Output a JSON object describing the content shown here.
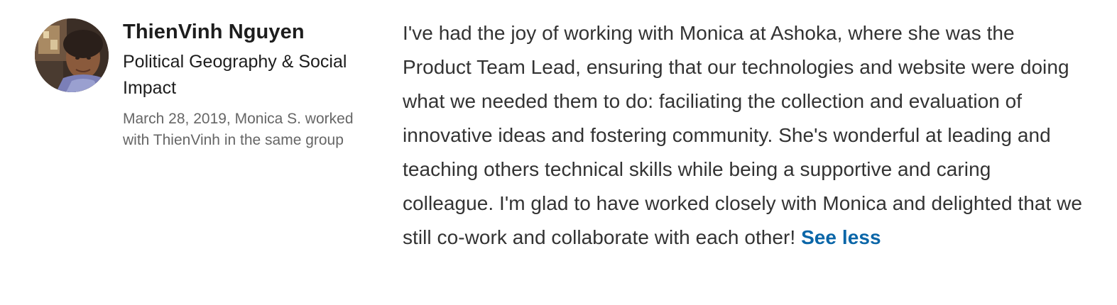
{
  "recommender": {
    "avatar_icon": "profile-photo",
    "name": "ThienVinh Nguyen",
    "headline": "Political Geography & Social Impact",
    "meta": "March 28, 2019, Monica S. worked with ThienVinh in the same group"
  },
  "recommendation": {
    "text": "I've had the joy of working with Monica at Ashoka, where she was the Product Team Lead, ensuring that our technologies and website were doing what we needed them to do: faciliating the collection and evaluation of innovative ideas and fostering community. She's wonderful at leading and teaching others technical skills while being a supportive and caring colleague. I'm glad to have worked closely with Monica and delighted that we still co-work and collaborate with each other!",
    "toggle_label": "See less",
    "toggle_color": "#0a66a8"
  }
}
